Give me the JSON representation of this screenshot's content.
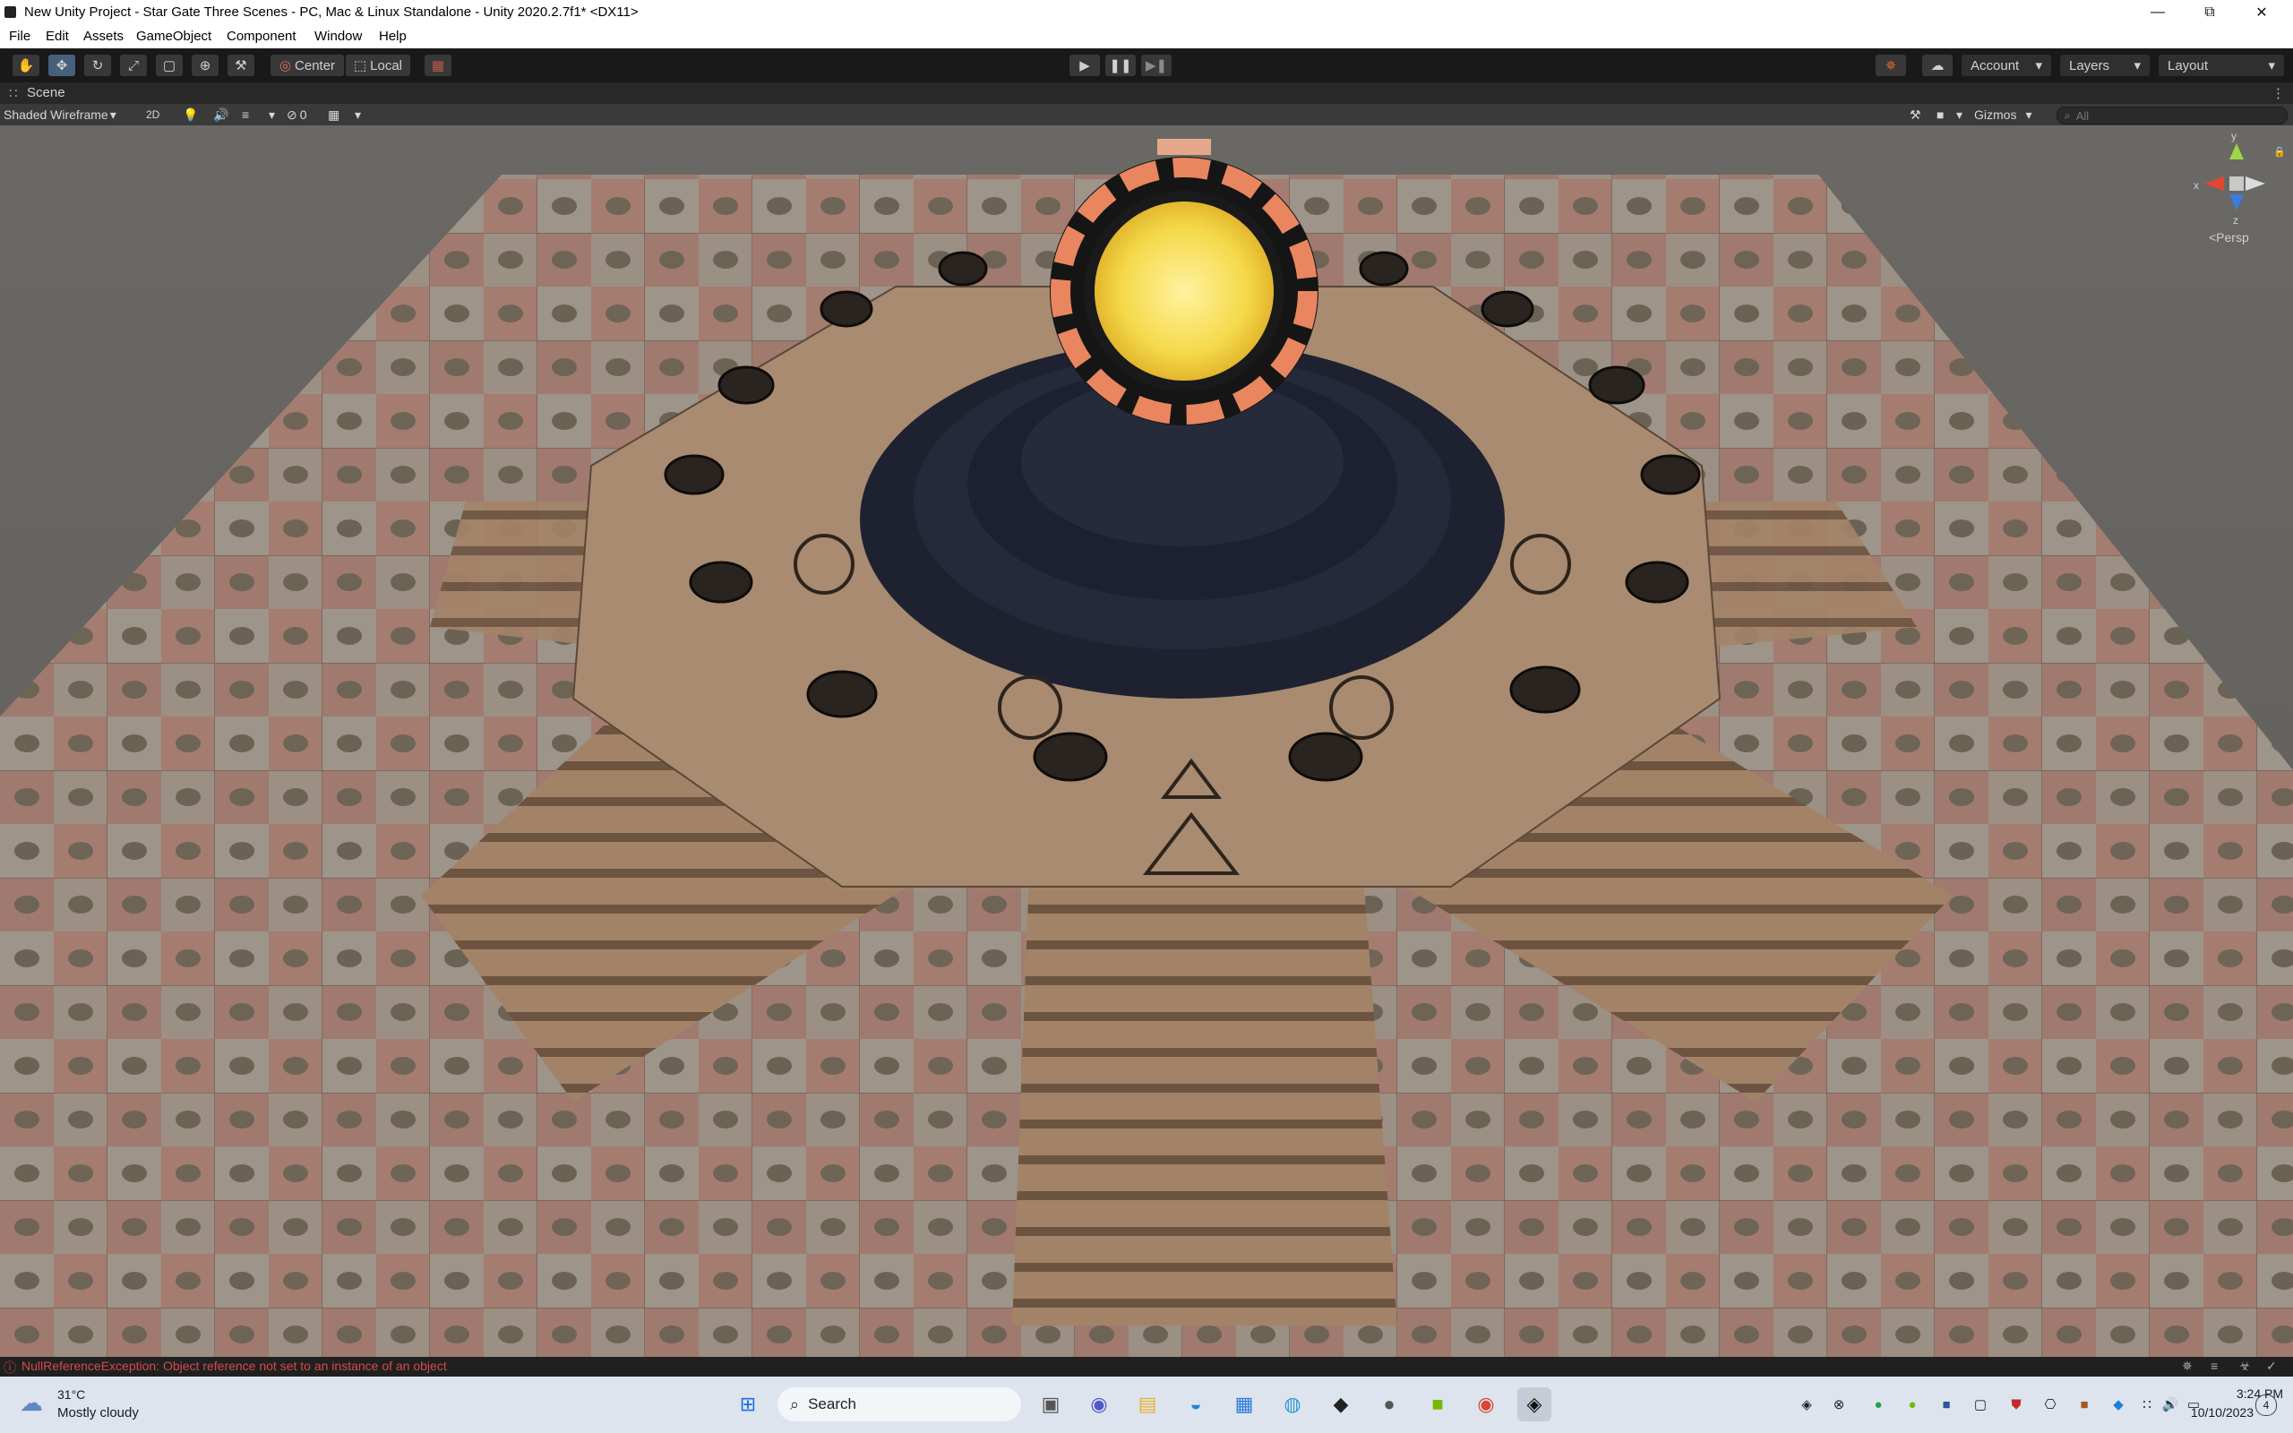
{
  "window": {
    "title": "New Unity Project - Star Gate Three Scenes - PC, Mac & Linux Standalone - Unity 2020.2.7f1* <DX11>",
    "controls": [
      "minimize",
      "maximize",
      "close"
    ]
  },
  "menu": [
    "File",
    "Edit",
    "Assets",
    "GameObject",
    "Component",
    "Window",
    "Help"
  ],
  "toolbar": {
    "tools": [
      "hand-tool",
      "move-tool",
      "rotate-tool",
      "scale-tool",
      "rect-tool",
      "transform-tool",
      "custom-tool"
    ],
    "pivot_label": "Center",
    "space_label": "Local",
    "account_label": "Account",
    "layers_label": "Layers",
    "layout_label": "Layout"
  },
  "scene": {
    "tab_label": "Scene",
    "draw_mode": "Shaded Wireframe",
    "mode_2d": "2D",
    "hidden_count": "0",
    "gizmos_label": "Gizmos",
    "search_placeholder": "All",
    "gizmo": {
      "x": "x",
      "y": "y",
      "z": "z",
      "projection": "<Persp"
    }
  },
  "status": {
    "message": "NullReferenceException: Object reference not set to an instance of an object"
  },
  "taskbar": {
    "weather_temp": "31°C",
    "weather_desc": "Mostly cloudy",
    "search_label": "Search",
    "time": "3:24 PM",
    "date": "10/10/2023",
    "notification_count": "4"
  },
  "colors": {
    "accent": "#46607c",
    "error": "#d24b4b",
    "portal_glow": "#f5d94a",
    "portal_frame": "#e9865f"
  }
}
